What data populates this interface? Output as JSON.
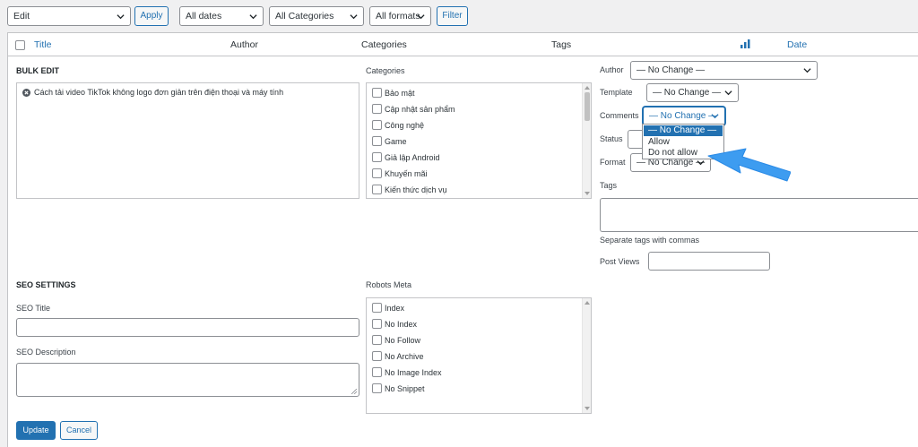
{
  "toolbar": {
    "bulk_action": "Edit",
    "apply": "Apply",
    "dates": "All dates",
    "categories": "All Categories",
    "formats": "All formats",
    "filter": "Filter"
  },
  "columns": {
    "title": "Title",
    "author": "Author",
    "categories": "Categories",
    "tags": "Tags",
    "date": "Date"
  },
  "bulk_edit": {
    "heading": "BULK EDIT",
    "post_title": "Cách tải video TikTok không logo đơn giản trên điện thoại và máy tính",
    "categories_label": "Categories",
    "categories": [
      "Bảo mật",
      "Cập nhật sản phẩm",
      "Công nghệ",
      "Game",
      "Giả lập Android",
      "Khuyến mãi",
      "Kiến thức dịch vụ"
    ]
  },
  "right_fields": {
    "author_label": "Author",
    "author_value": "— No Change —",
    "template_label": "Template",
    "template_value": "— No Change —",
    "comments_label": "Comments",
    "comments_value": "— No Change —",
    "status_label": "Status",
    "format_label": "Format",
    "format_value": "— No Change —",
    "tags_label": "Tags",
    "tags_hint": "Separate tags with commas",
    "post_views_label": "Post Views"
  },
  "comments_dropdown": {
    "options": [
      "— No Change —",
      "Allow",
      "Do not allow"
    ],
    "selected": "— No Change —"
  },
  "seo": {
    "heading": "SEO SETTINGS",
    "title_label": "SEO Title",
    "description_label": "SEO Description"
  },
  "robots": {
    "label": "Robots Meta",
    "items": [
      "Index",
      "No Index",
      "No Follow",
      "No Archive",
      "No Image Index",
      "No Snippet"
    ]
  },
  "actions": {
    "update": "Update",
    "cancel": "Cancel"
  },
  "annotation": {
    "arrow_color": "#3d9cf0"
  }
}
